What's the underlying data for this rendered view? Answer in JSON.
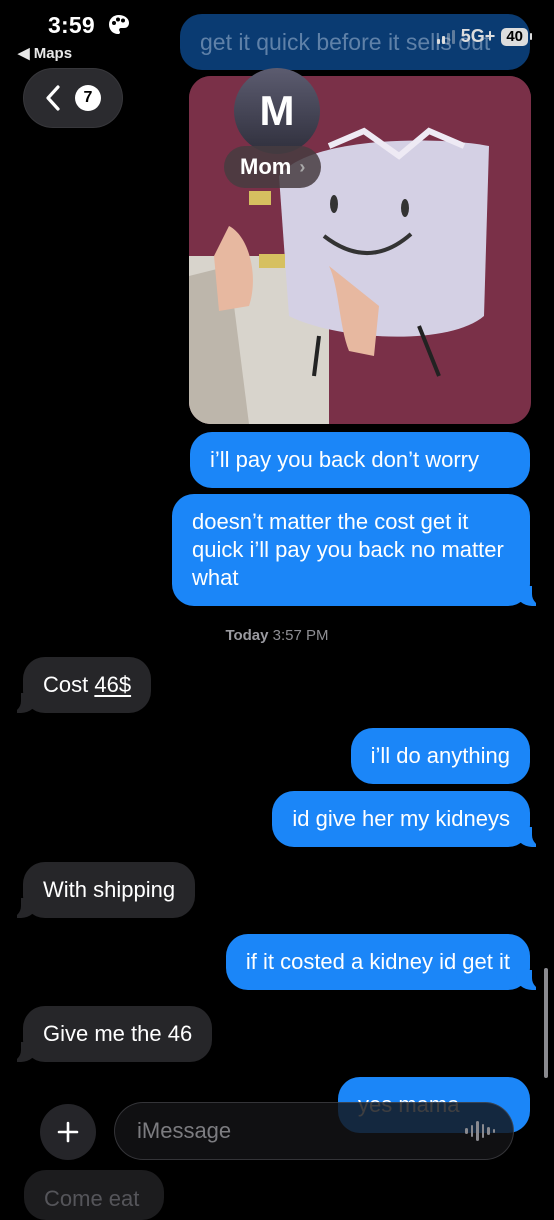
{
  "status_bar": {
    "time": "3:59",
    "back_app": "◀ Maps",
    "network": "5G+",
    "battery": "40"
  },
  "nav": {
    "back_count": "7",
    "contact_initial": "M",
    "contact_name": "Mom"
  },
  "messages": {
    "faded_top": "get it quick before it sells out",
    "sent_1": "i’ll pay you back don’t worry",
    "sent_2": "doesn’t matter the cost get it quick i’ll pay you back no matter what",
    "timestamp_day": "Today",
    "timestamp_time": "3:57 PM",
    "recv_1_prefix": "Cost ",
    "recv_1_link": "46$",
    "sent_3": "i’ll do anything",
    "sent_4": "id give her my kidneys",
    "recv_2": "With shipping",
    "sent_5": "if it costed a kidney id get it",
    "recv_3": "Give me the 46",
    "sent_6_partial": "yes mama",
    "recv_4_partial": "Come eat"
  },
  "composer": {
    "placeholder": "iMessage"
  },
  "colors": {
    "sent_bubble": "#1b86f8",
    "recv_bubble": "#262629",
    "background": "#000000"
  }
}
